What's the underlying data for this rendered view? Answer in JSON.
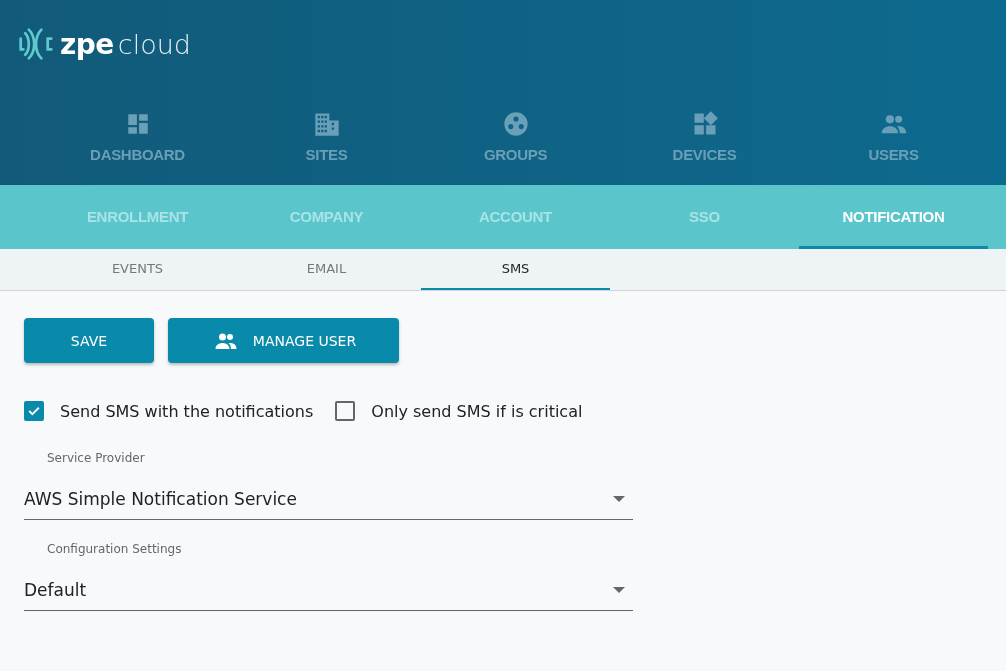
{
  "logo": {
    "brand": "zpe",
    "product": "cloud"
  },
  "main_nav": [
    {
      "label": "DASHBOARD",
      "kind": "dashboard"
    },
    {
      "label": "SITES",
      "kind": "sites"
    },
    {
      "label": "GROUPS",
      "kind": "groups"
    },
    {
      "label": "DEVICES",
      "kind": "devices"
    },
    {
      "label": "USERS",
      "kind": "users"
    }
  ],
  "settings_tabs": [
    {
      "label": "ENROLLMENT",
      "selected": false
    },
    {
      "label": "COMPANY",
      "selected": false
    },
    {
      "label": "ACCOUNT",
      "selected": false
    },
    {
      "label": "SSO",
      "selected": false
    },
    {
      "label": "NOTIFICATION",
      "selected": true
    }
  ],
  "notification_tabs": [
    {
      "label": "EVENTS",
      "selected": false
    },
    {
      "label": "EMAIL",
      "selected": false
    },
    {
      "label": "SMS",
      "selected": true
    }
  ],
  "buttons": [
    {
      "label": "SAVE",
      "kind": "plain"
    },
    {
      "label": "MANAGE USER",
      "kind": "users"
    }
  ],
  "checkboxes": [
    {
      "label": "Send SMS with the notifications",
      "checked": true
    },
    {
      "label": "Only send SMS if is critical",
      "checked": false
    }
  ],
  "selects": [
    {
      "label": "Service Provider",
      "value": "AWS Simple Notification Service"
    },
    {
      "label": "Configuration Settings",
      "value": "Default"
    }
  ]
}
